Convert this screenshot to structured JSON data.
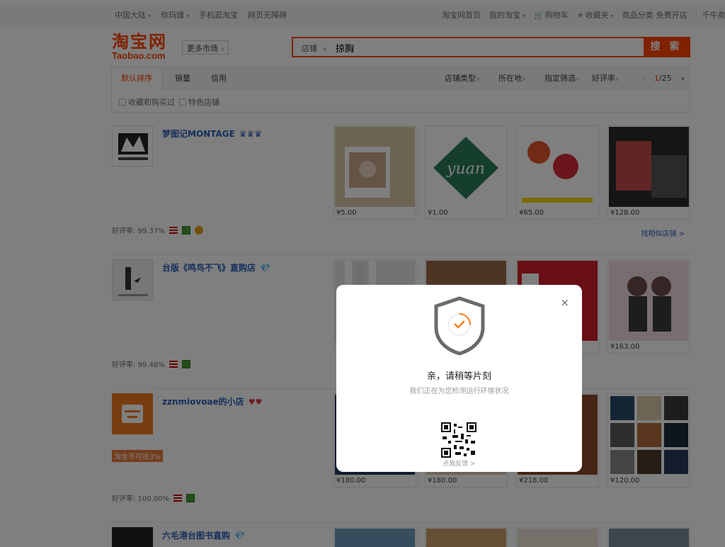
{
  "colors": {
    "brand": "#ff4400",
    "link": "#2a5fb8",
    "overlay": "rgba(0,0,0,0.5)"
  },
  "topbar": {
    "left": [
      "中国大陆",
      "你玛瑰",
      "手机逛淘宝",
      "网页无障碍"
    ],
    "right": [
      "淘宝网首页",
      "我的淘宝",
      "购物车",
      "收藏夹",
      "商品分类",
      "免费开店",
      "千牛卖"
    ]
  },
  "header": {
    "logo_cn": "淘宝网",
    "logo_en": "Taobao.com",
    "more_market": "更多市场"
  },
  "search": {
    "scope": "店铺",
    "value": "掠胸",
    "button": "搜 索"
  },
  "sortbar": {
    "tabs": [
      "默认排序",
      "销量",
      "信用"
    ],
    "filters": [
      "店铺类型",
      "所在地",
      "指定筛选",
      "好评率"
    ],
    "page_current": "1",
    "page_total": "/25"
  },
  "checks": [
    "收藏和购买过",
    "特色店铺"
  ],
  "shops": [
    {
      "name": "梦图记MONTAGE",
      "rating": "好评率: 99.37%",
      "similar": "找相似店铺 >",
      "items": [
        {
          "price": "¥5.00"
        },
        {
          "price": "¥1.00"
        },
        {
          "price": "¥65.00"
        },
        {
          "price": "¥128.00"
        }
      ]
    },
    {
      "name": "台版《鸣鸟不飞》直购店",
      "rating": "好评率: 99.46%",
      "items": [
        {
          "price": ""
        },
        {
          "price": ""
        },
        {
          "price": ""
        },
        {
          "price": "¥163.00"
        }
      ]
    },
    {
      "name": "zznmiovoae的小店",
      "promo": "淘金币可抵3%",
      "rating": "好评率: 100.00%",
      "items": [
        {
          "price": "¥180.00"
        },
        {
          "price": "¥180.00"
        },
        {
          "price": "¥218.00"
        },
        {
          "price": "¥120.00"
        }
      ]
    },
    {
      "name": "六毛港台图书直购",
      "items": []
    }
  ],
  "modal": {
    "title": "亲，请稍等片刻",
    "subtitle": "我们正在为您检测运行环境状况",
    "feedback": "点我反馈 >",
    "close": "×"
  }
}
